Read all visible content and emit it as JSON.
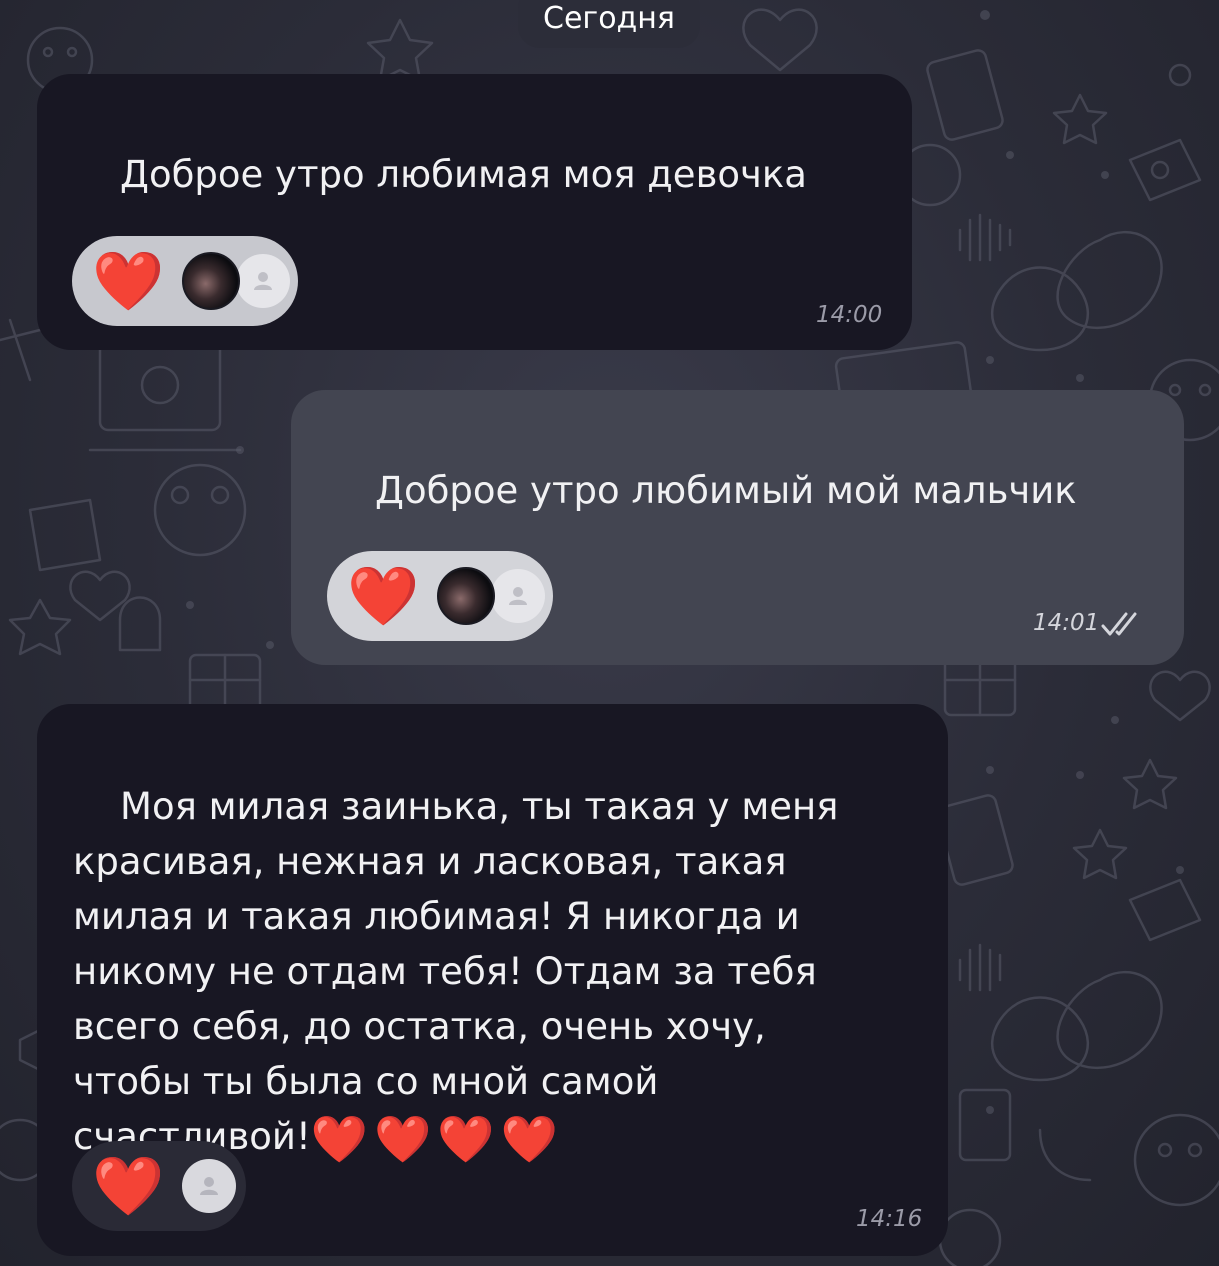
{
  "date_separator": "Сегодня",
  "messages": [
    {
      "direction": "incoming",
      "text": "Доброе утро любимая моя девочка",
      "emoji": "❤️",
      "reaction": "❤️",
      "time": "14:00"
    },
    {
      "direction": "outgoing",
      "text": "Доброе утро любимый мой мальчик",
      "emoji": "❤️",
      "reaction": "❤️",
      "time": "14:01",
      "read_status": "read"
    },
    {
      "direction": "incoming",
      "text": "Моя милая заинька, ты такая у меня\nкрасивая, нежная и ласковая, такая\nмилая и такая любимая! Я никогда и\nникому не отдам тебя! Отдам за тебя\nвсего себя, до остатка, очень хочу,\nчтобы ты была со мной самой\nсчастливой!",
      "emoji": "❤️❤️❤️❤️",
      "reaction": "❤️",
      "time": "14:16"
    }
  ],
  "colors": {
    "incoming_bubble": "#181723",
    "outgoing_bubble": "#434551",
    "background": "#2b2c38",
    "heart": "#d8161a"
  },
  "icons": [
    "heart-reaction-icon",
    "user-avatar-icon",
    "double-check-icon"
  ]
}
